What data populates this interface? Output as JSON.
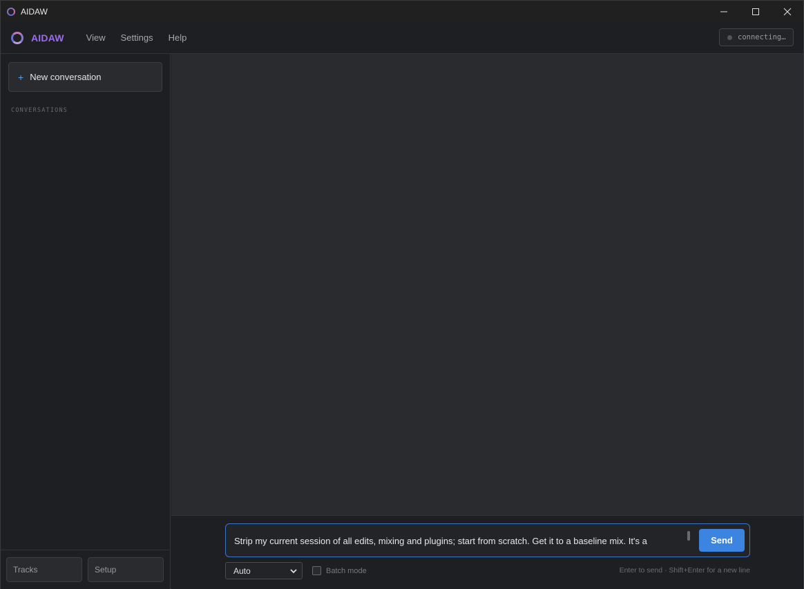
{
  "window": {
    "title": "AIDAW"
  },
  "menubar": {
    "brand": "AIDAW",
    "items": [
      "View",
      "Settings",
      "Help"
    ],
    "status": "connecting…"
  },
  "sidebar": {
    "new_conversation": "New conversation",
    "conversations_header": "CONVERSATIONS",
    "footer": {
      "tracks": "Tracks",
      "setup": "Setup"
    }
  },
  "composer": {
    "input_value": "Strip my current session of all edits, mixing and plugins; start from scratch. Get it to a baseline mix. It's a",
    "send_label": "Send",
    "mode_selected": "Auto",
    "batch_label": "Batch mode",
    "batch_checked": false,
    "hint": "Enter to send · Shift+Enter for a new line"
  },
  "colors": {
    "accent": "#3b84e0",
    "brand": "#9b6cf0",
    "background": "#2a2b2e"
  }
}
